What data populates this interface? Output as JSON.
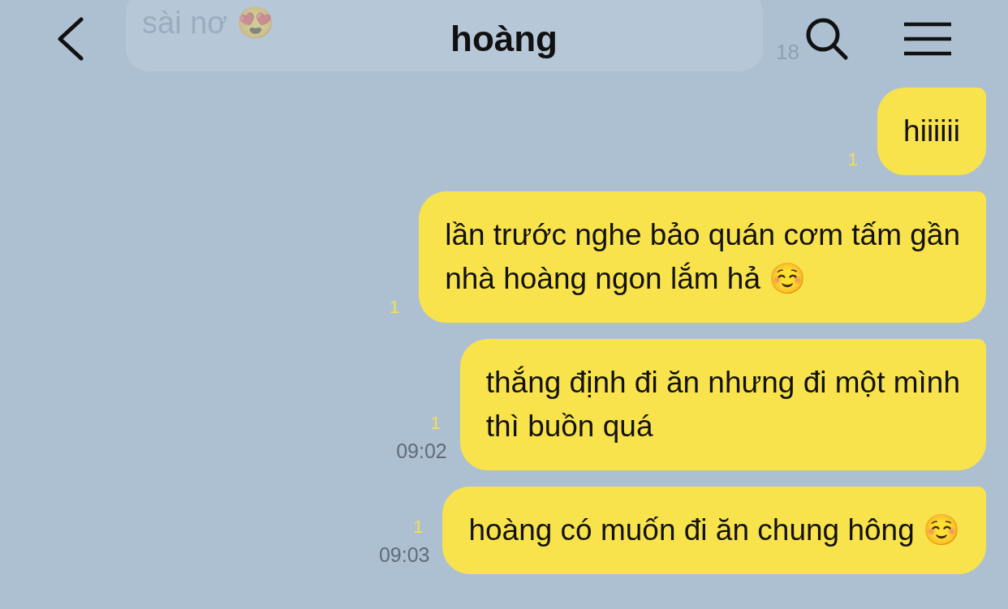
{
  "header": {
    "title": "hoàng"
  },
  "messages": [
    {
      "kind": "incoming",
      "text": "sài nơ 😍",
      "time": "18"
    },
    {
      "kind": "outgoing",
      "text": "hiiiiii",
      "read_count": "1"
    },
    {
      "kind": "outgoing",
      "text": "lần trước nghe bảo quán cơm tấm gần\nnhà hoàng ngon lắm hả ☺️",
      "read_count": "1"
    },
    {
      "kind": "outgoing",
      "text": "thắng định đi ăn nhưng đi một mình\nthì buồn quá",
      "read_count": "1",
      "time": "09:02"
    },
    {
      "kind": "outgoing",
      "text": "hoàng có muốn đi ăn chung hông ☺️",
      "read_count": "1",
      "time": "09:03"
    }
  ]
}
